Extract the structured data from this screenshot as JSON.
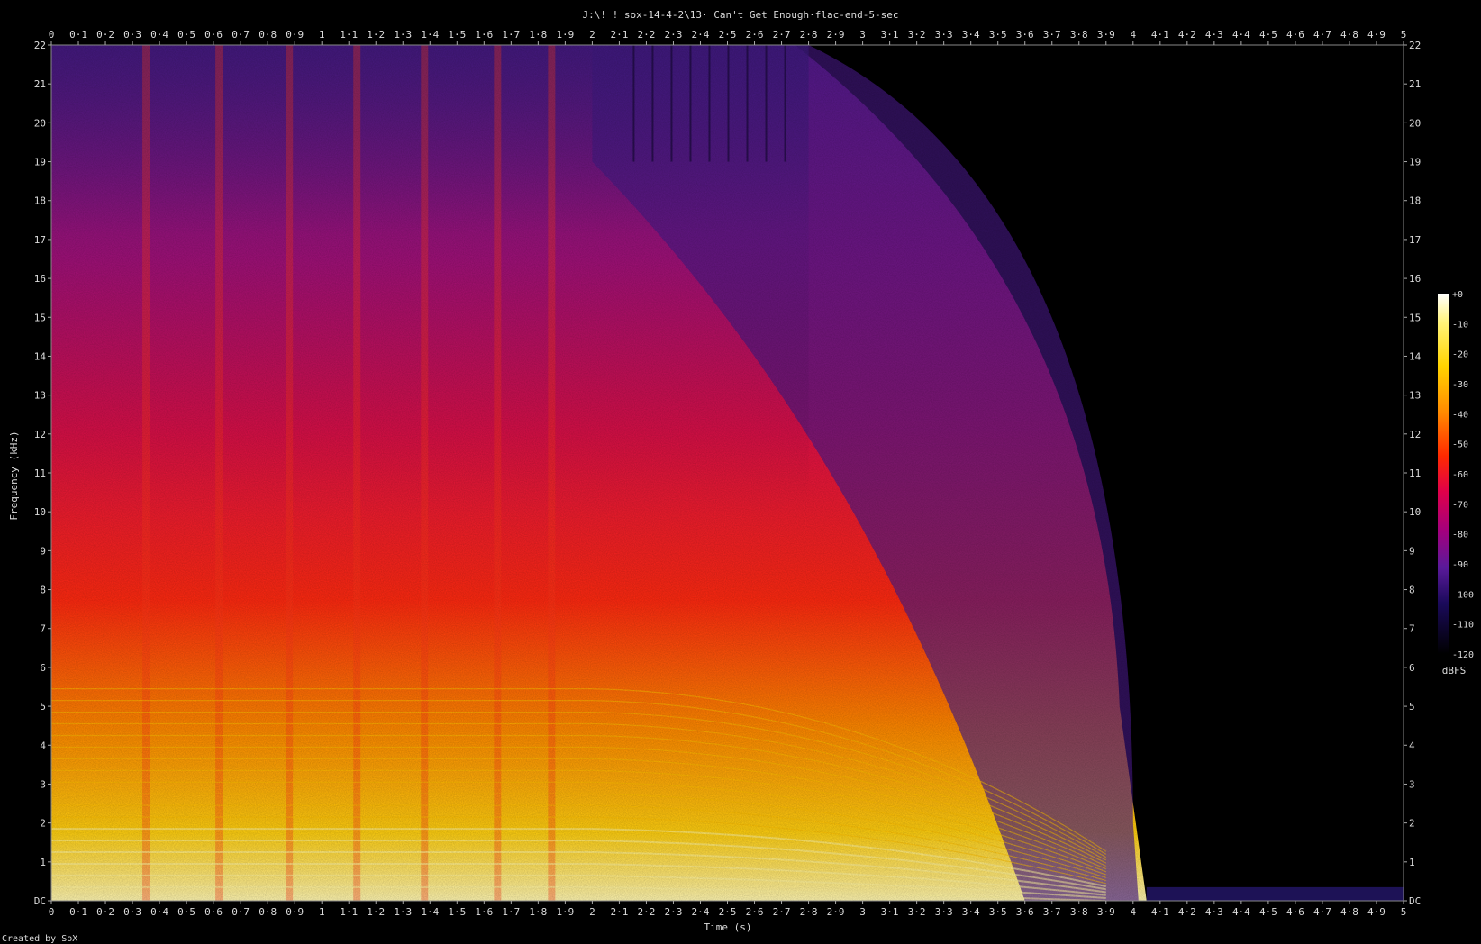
{
  "chart_data": {
    "type": "heatmap",
    "title": "J:\\! ! sox-14-4-2\\13· Can't Get Enough·flac-end-5-sec",
    "xlabel": "Time (s)",
    "ylabel": "Frequency (kHz)",
    "xlim": [
      0,
      5
    ],
    "ylim": [
      0,
      22
    ],
    "x_ticks": [
      "0",
      "0·1",
      "0·2",
      "0·3",
      "0·4",
      "0·5",
      "0·6",
      "0·7",
      "0·8",
      "0·9",
      "1",
      "1·1",
      "1·2",
      "1·3",
      "1·4",
      "1·5",
      "1·6",
      "1·7",
      "1·8",
      "1·9",
      "2",
      "2·1",
      "2·2",
      "2·3",
      "2·4",
      "2·5",
      "2·6",
      "2·7",
      "2·8",
      "2·9",
      "3",
      "3·1",
      "3·2",
      "3·3",
      "3·4",
      "3·5",
      "3·6",
      "3·7",
      "3·8",
      "3·9",
      "4",
      "4·1",
      "4·2",
      "4·3",
      "4·4",
      "4·5",
      "4·6",
      "4·7",
      "4·8",
      "4·9",
      "5"
    ],
    "y_ticks": [
      "DC",
      "1",
      "2",
      "3",
      "4",
      "5",
      "6",
      "7",
      "8",
      "9",
      "10",
      "11",
      "12",
      "13",
      "14",
      "15",
      "16",
      "17",
      "18",
      "19",
      "20",
      "21",
      "22"
    ],
    "colorbar": {
      "label": "dBFS",
      "ticks": [
        "+0",
        "-10",
        "-20",
        "-30",
        "-40",
        "-50",
        "-60",
        "-70",
        "-80",
        "-90",
        "-100",
        "-110",
        "-120"
      ],
      "range": [
        -120,
        0
      ]
    },
    "footer": "Created by SoX",
    "colors": {
      "background": "#000000",
      "text": "#dcdcdc",
      "frame": "#888888"
    }
  }
}
